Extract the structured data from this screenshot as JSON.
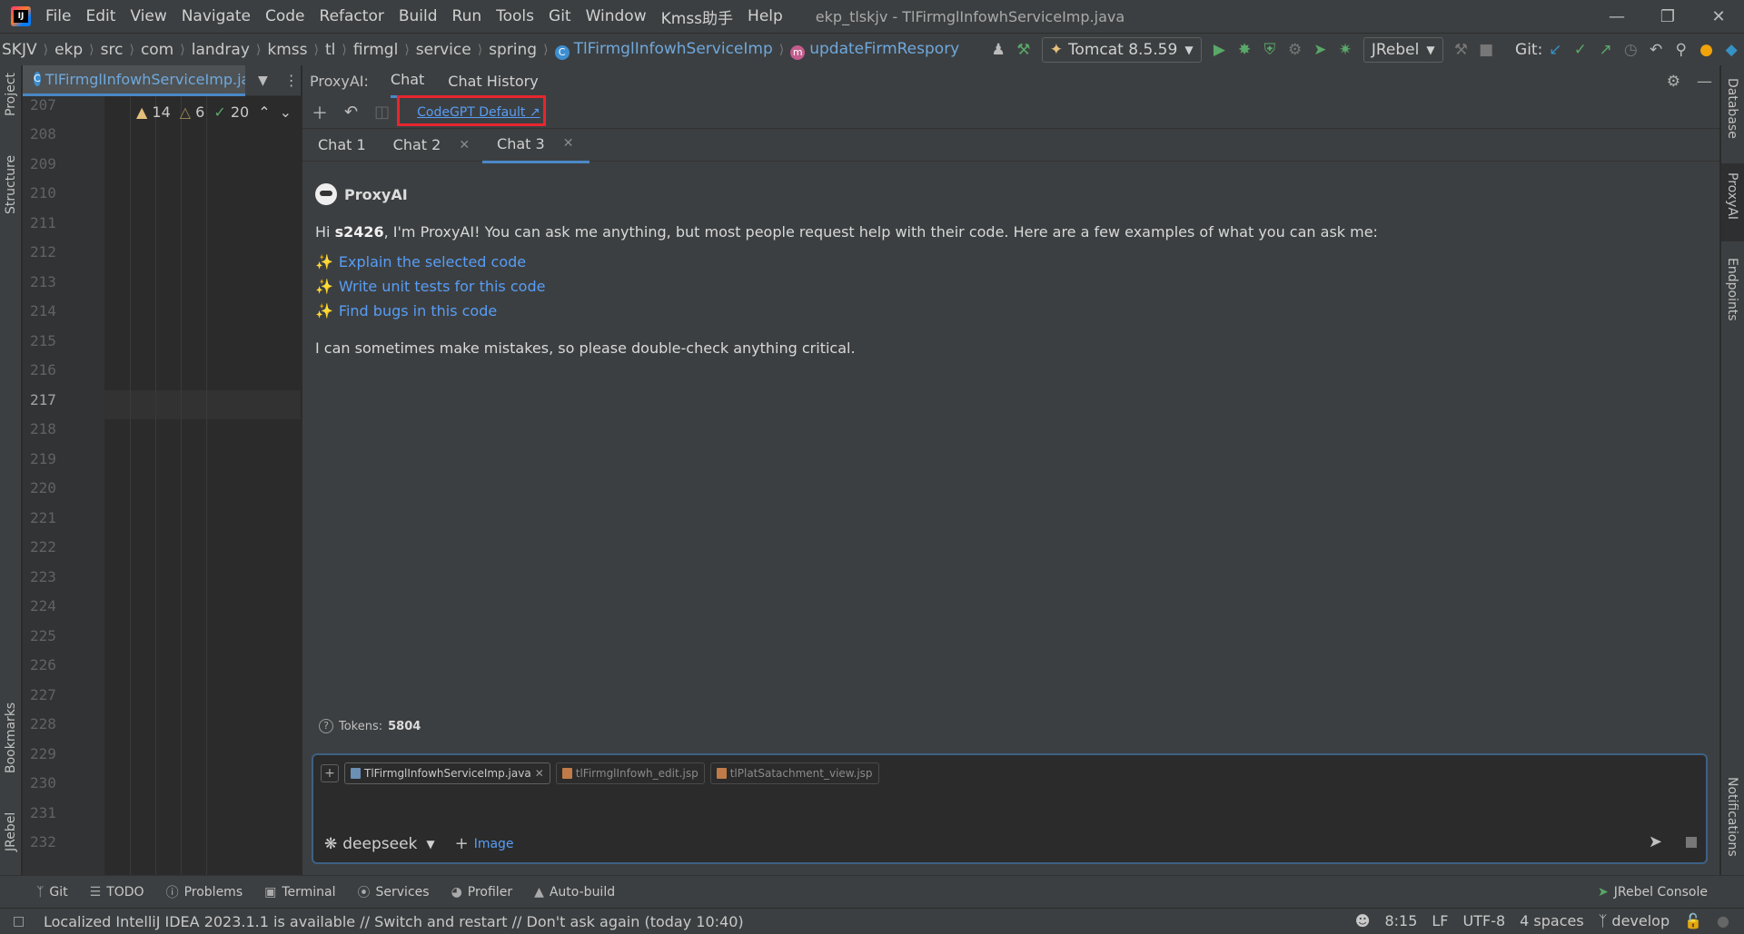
{
  "menubar": {
    "items": [
      "File",
      "Edit",
      "View",
      "Navigate",
      "Code",
      "Refactor",
      "Build",
      "Run",
      "Tools",
      "Git",
      "Window",
      "Kmss助手",
      "Help"
    ],
    "window_title": "ekp_tlskjv - TlFirmglInfowhServiceImp.java"
  },
  "navbar": {
    "breadcrumb": [
      "SKJV",
      "ekp",
      "src",
      "com",
      "landray",
      "kmss",
      "tl",
      "firmgl",
      "service",
      "spring"
    ],
    "class_name": "TlFirmglInfowhServiceImp",
    "method_name": "updateFirmRespory",
    "run_config": "Tomcat 8.5.59",
    "jrebel": "JRebel",
    "git_label": "Git:"
  },
  "left_strip": {
    "project": "Project",
    "structure": "Structure",
    "bookmarks": "Bookmarks",
    "jrebel": "JRebel"
  },
  "right_strip": {
    "database": "Database",
    "proxyai": "ProxyAI",
    "endpoints": "Endpoints",
    "notifications": "Notifications"
  },
  "editor": {
    "tab_label": "TlFirmglInfowhServiceImp.ja",
    "warnings": "14",
    "weak_warnings": "6",
    "ok_count": "20",
    "line_numbers": [
      "207",
      "208",
      "209",
      "210",
      "211",
      "212",
      "213",
      "214",
      "215",
      "216",
      "217",
      "218",
      "219",
      "220",
      "221",
      "222",
      "223",
      "224",
      "225",
      "226",
      "227",
      "228",
      "229",
      "230",
      "231",
      "232"
    ],
    "current_line": "217"
  },
  "panel": {
    "title": "ProxyAI:",
    "tabs": [
      "Chat",
      "Chat History"
    ],
    "model_link": "CodeGPT Default",
    "chat_tabs": [
      "Chat 1",
      "Chat 2",
      "Chat 3"
    ],
    "bot_name": "ProxyAI",
    "greeting_pre": "Hi ",
    "user": "s2426",
    "greeting_post": ", I'm ProxyAI! You can ask me anything, but most people request help with their code. Here are a few examples of what you can ask me:",
    "suggestions": [
      "Explain the selected code",
      "Write unit tests for this code",
      "Find bugs in this code"
    ],
    "disclaimer": "I can sometimes make mistakes, so please double-check anything critical.",
    "tokens_label": "Tokens:",
    "tokens_value": "5804",
    "files": [
      "TlFirmglInfowhServiceImp.java",
      "tlFirmglInfowh_edit.jsp",
      "tlPlatSatachment_view.jsp"
    ],
    "model": "deepseek",
    "image_label": "Image"
  },
  "bottom_tools": [
    "Git",
    "TODO",
    "Problems",
    "Terminal",
    "Services",
    "Profiler",
    "Auto-build"
  ],
  "jrebel_console": "JRebel Console",
  "status": {
    "message": "Localized IntelliJ IDEA 2023.1.1 is available // Switch and restart // Don't ask again (today 10:40)",
    "position": "8:15",
    "line_sep": "LF",
    "encoding": "UTF-8",
    "indent": "4 spaces",
    "branch": "develop"
  },
  "colors": {
    "accent": "#4a88c7",
    "link": "#589df6",
    "highlight_box": "#e8252f"
  }
}
